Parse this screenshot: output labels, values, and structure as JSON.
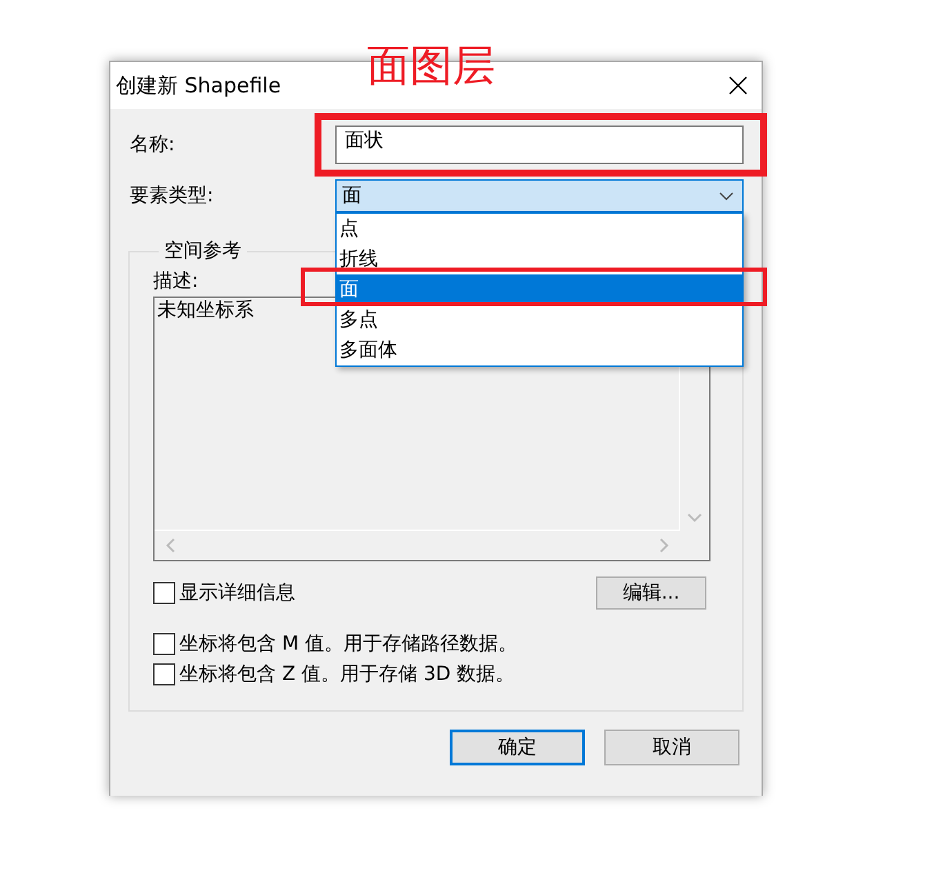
{
  "annotation": {
    "label": "面图层"
  },
  "window": {
    "title": "创建新 Shapefile"
  },
  "name_field": {
    "label": "名称:",
    "value": "面状"
  },
  "feature_type": {
    "label": "要素类型:",
    "value": "面",
    "expanded": true,
    "options": [
      {
        "label": "点",
        "selected": false
      },
      {
        "label": "折线",
        "selected": false
      },
      {
        "label": "面",
        "selected": true
      },
      {
        "label": "多点",
        "selected": false
      },
      {
        "label": "多面体",
        "selected": false
      }
    ]
  },
  "spatial_reference": {
    "legend": "空间参考",
    "description_label": "描述:",
    "description": "未知坐标系",
    "show_details": {
      "label": "显示详细信息",
      "checked": false
    },
    "edit_button": "编辑..."
  },
  "options": [
    {
      "label": "坐标将包含 M 值。用于存储路径数据。",
      "checked": false
    },
    {
      "label": "坐标将包含 Z 值。用于存储 3D 数据。",
      "checked": false
    }
  ],
  "buttons": [
    {
      "label": "确定",
      "default": true
    },
    {
      "label": "取消",
      "default": false
    }
  ]
}
